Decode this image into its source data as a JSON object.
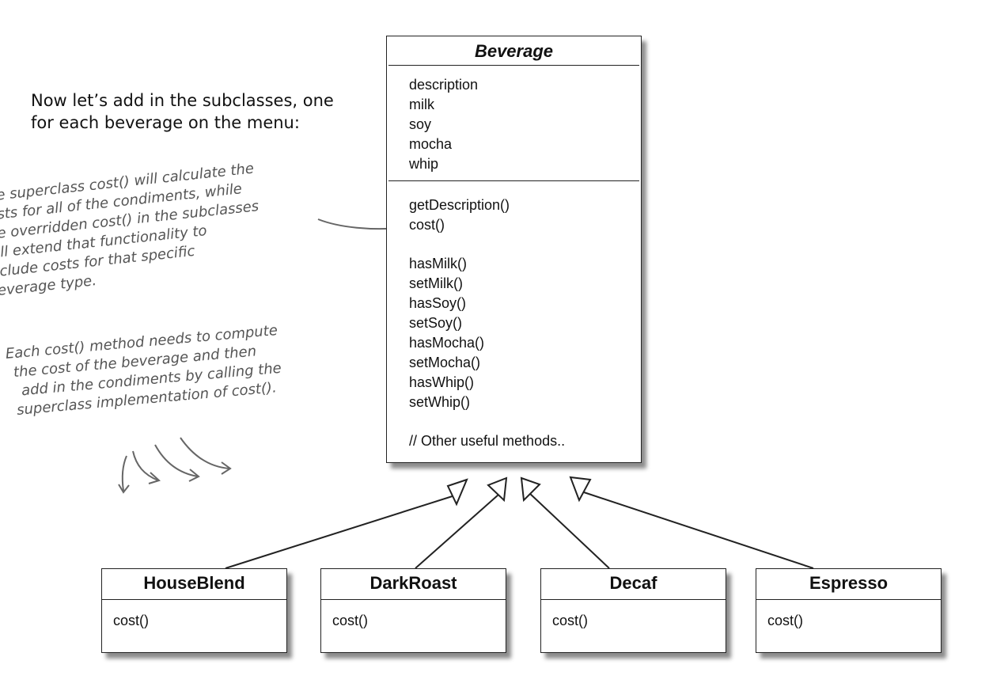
{
  "intro": {
    "line1": "Now let’s add in the subclasses, one",
    "line2": "for each beverage on the menu:"
  },
  "notes": {
    "superclass": [
      "The superclass cost() will calculate the",
      "costs for all of the condiments, while",
      "the overridden cost() in the subclasses",
      "will extend that functionality to",
      "include costs for that specific",
      "beverage type."
    ],
    "each_cost": [
      "Each cost() method needs to compute",
      "the cost of the beverage and then",
      "add in the condiments by calling the",
      "superclass implementation of cost()."
    ]
  },
  "beverage": {
    "name": "Beverage",
    "attributes": [
      "description",
      "milk",
      "soy",
      "mocha",
      "whip"
    ],
    "methods_a": [
      "getDescription()",
      "cost()"
    ],
    "methods_b": [
      "hasMilk()",
      "setMilk()",
      "hasSoy()",
      "setSoy()",
      "hasMocha()",
      "setMocha()",
      "hasWhip()",
      "setWhip()"
    ],
    "methods_c": [
      "// Other useful methods.."
    ]
  },
  "subclasses": [
    {
      "name": "HouseBlend",
      "method": "cost()"
    },
    {
      "name": "DarkRoast",
      "method": "cost()"
    },
    {
      "name": "Decaf",
      "method": "cost()"
    },
    {
      "name": "Espresso",
      "method": "cost()"
    }
  ],
  "colors": {
    "line": "#222222",
    "handwriting": "#555555"
  }
}
